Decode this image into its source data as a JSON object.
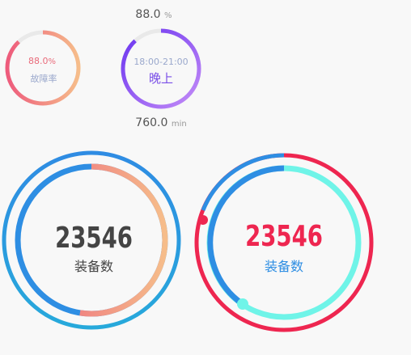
{
  "gauge_small_1": {
    "percent_value": "88.0",
    "percent_unit": "%",
    "caption": "故障率",
    "fill_fraction": 0.88
  },
  "gauge_small_2": {
    "top_value": "88.0",
    "top_unit": "%",
    "time_range": "18:00-21:00",
    "period_label": "晚上",
    "bottom_value": "760.0",
    "bottom_unit": "min",
    "fill_fraction": 0.88
  },
  "gauge_big_1": {
    "value": "23546",
    "caption": "装备数"
  },
  "gauge_big_2": {
    "value": "23546",
    "caption": "装备数"
  },
  "colors": {
    "pink": "#ec5f7c",
    "peach": "#f6ba8a",
    "purple_start": "#6a34f0",
    "purple_end": "#c17cf6",
    "blue": "#2e8ee3",
    "cyan_blue": "#2aa6dd",
    "red": "#ee2650",
    "aqua": "#6ff4e8",
    "track": "#e9e9e9"
  }
}
